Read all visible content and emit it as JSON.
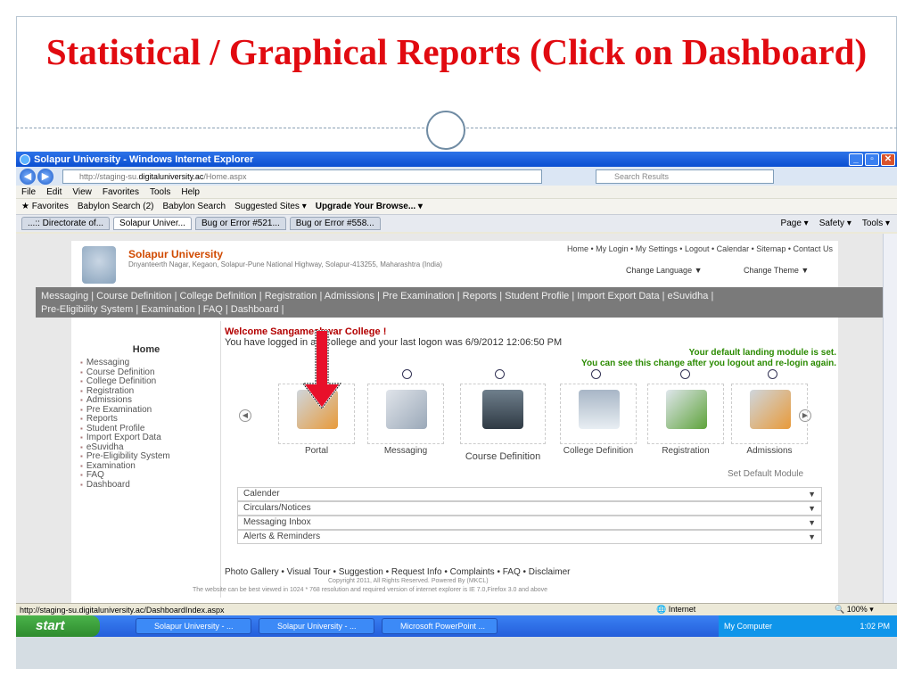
{
  "slide": {
    "title": "Statistical / Graphical Reports (Click on Dashboard)"
  },
  "browser": {
    "window_title": "Solapur University - Windows Internet Explorer",
    "address_prefix": "http://staging-su.",
    "address_domain": "digitaluniversity.ac",
    "address_path": "/Home.aspx",
    "search_placeholder": "Search Results",
    "menu": [
      "File",
      "Edit",
      "View",
      "Favorites",
      "Tools",
      "Help"
    ],
    "favorites_label": "Favorites",
    "favorites_links": [
      "Babylon Search (2)",
      "Babylon Search",
      "Suggested Sites ▾",
      "Upgrade Your Browse... ▾"
    ],
    "tabs": [
      "...:: Directorate of...",
      "Solapur Univer...",
      "Bug or Error #521...",
      "Bug or Error #558..."
    ],
    "commands": [
      "Page ▾",
      "Safety ▾",
      "Tools ▾"
    ],
    "status_url": "http://staging-su.digitaluniversity.ac/DashboardIndex.aspx",
    "status_zone": "Internet",
    "zoom": "100%"
  },
  "site": {
    "university_name": "Solapur University",
    "university_address": "Dnyanteerth Nagar, Kegaon, Solapur-Pune National Highway, Solapur-413255, Maharashtra (India)",
    "top_links": "Home  • My Login  • My Settings  • Logout  • Calendar  • Sitemap  • Contact Us",
    "change_language": "Change Language",
    "change_theme": "Change Theme",
    "menu_line1": "Messaging | Course Definition | College Definition | Registration | Admissions | Pre Examination | Reports | Student Profile | Import Export Data | eSuvidha |",
    "menu_line2": "Pre-Eligibility System | Examination | FAQ | Dashboard |",
    "sidebar_title": "Home",
    "sidebar_items": [
      "Messaging",
      "Course Definition",
      "College Definition",
      "Registration",
      "Admissions",
      "Pre Examination",
      "Reports",
      "Student Profile",
      "Import Export Data",
      "eSuvidha",
      "Pre-Eligibility System",
      "Examination",
      "FAQ",
      "Dashboard"
    ],
    "welcome_line1": "Welcome Sangameshwar College !",
    "welcome_line2": "You have logged in as College and your last logon was 6/9/2012 12:06:50 PM",
    "note_line1": "Your default landing module is set.",
    "note_line2": "You can see this change after you logout and re-login again.",
    "modules": [
      "Portal",
      "Messaging",
      "Course Definition",
      "College Definition",
      "Registration",
      "Admissions"
    ],
    "set_default": "Set Default Module",
    "accordions": [
      "Calender",
      "Circulars/Notices",
      "Messaging Inbox",
      "Alerts & Reminders"
    ],
    "footer_links": "Photo Gallery  • Visual Tour  • Suggestion  • Request Info  • Complaints  • FAQ  • Disclaimer",
    "copyright": "Copyright 2011, All Rights Reserved. Powered By (MKCL)",
    "best_view": "The website can be best viewed in 1024 * 768 resolution and required version of internet explorer is IE 7.0,Firefox 3.0 and above"
  },
  "taskbar": {
    "start": "start",
    "tasks": [
      "Solapur University - ...",
      "Solapur University - ...",
      "Microsoft PowerPoint ..."
    ],
    "tray_label": "My Computer",
    "clock": "1:02 PM"
  }
}
